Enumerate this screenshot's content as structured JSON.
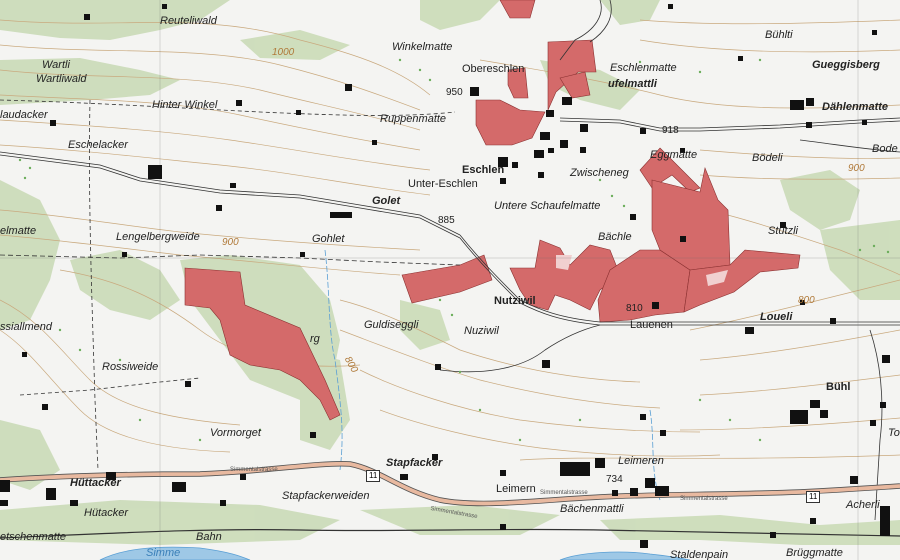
{
  "colors": {
    "background": "#f4f4f2",
    "forest": "#c8d9b4",
    "zone": "#d46a6a",
    "zone_edge": "#8a3030",
    "contour": "#c9a97e",
    "road": "#333333",
    "main_road": "#e8b9a0",
    "water": "#9ec8e6"
  },
  "places": [
    {
      "name": "Reuteliwald",
      "style": "it"
    },
    {
      "name": "Bühlti",
      "style": "it"
    },
    {
      "name": "Wartli",
      "style": "it"
    },
    {
      "name": "Wartliwald",
      "style": "it"
    },
    {
      "name": "Winkelmatte",
      "style": "it"
    },
    {
      "name": "Obereschlen",
      "style": ""
    },
    {
      "name": "Eschlenmatte",
      "style": "it"
    },
    {
      "name": "Gueggisberg",
      "style": "it b"
    },
    {
      "name": "ufelmattli",
      "style": "it b"
    },
    {
      "name": "Hinter Winkel",
      "style": "it"
    },
    {
      "name": "Dählenmatte",
      "style": "it b"
    },
    {
      "name": "laudacker",
      "style": "it"
    },
    {
      "name": "Ruppenmatte",
      "style": "it"
    },
    {
      "name": "Eschelacker",
      "style": "it"
    },
    {
      "name": "Eggmatte",
      "style": "it"
    },
    {
      "name": "Bödeli",
      "style": "it"
    },
    {
      "name": "Bode",
      "style": "it"
    },
    {
      "name": "Eschlen",
      "style": "b"
    },
    {
      "name": "Unter-Eschlen",
      "style": ""
    },
    {
      "name": "Zwischeneg",
      "style": "it"
    },
    {
      "name": "Golet",
      "style": "b it"
    },
    {
      "name": "Untere Schaufelmatte",
      "style": "it"
    },
    {
      "name": "Gohlet",
      "style": "it"
    },
    {
      "name": "Lengelbergweide",
      "style": "it"
    },
    {
      "name": "Bächle",
      "style": "it"
    },
    {
      "name": "Stutzli",
      "style": "it"
    },
    {
      "name": "elmatte",
      "style": "it"
    },
    {
      "name": "Nutziwil",
      "style": "b"
    },
    {
      "name": "Guldiseggli",
      "style": "it"
    },
    {
      "name": "Nuziwil",
      "style": "it"
    },
    {
      "name": "Lauenen",
      "style": ""
    },
    {
      "name": "Loueli",
      "style": "it b"
    },
    {
      "name": "ssiallmend",
      "style": "it"
    },
    {
      "name": "Rossiweide",
      "style": "it"
    },
    {
      "name": "Bühl",
      "style": "b"
    },
    {
      "name": "Vormorget",
      "style": "it"
    },
    {
      "name": "Tor",
      "style": "it"
    },
    {
      "name": "Stapfacker",
      "style": "b it"
    },
    {
      "name": "Leimeren",
      "style": "it"
    },
    {
      "name": "Hüttacker",
      "style": "b it"
    },
    {
      "name": "Leimern",
      "style": ""
    },
    {
      "name": "Hütacker",
      "style": "it"
    },
    {
      "name": "Stapfackerweiden",
      "style": "it"
    },
    {
      "name": "Bächenmattli",
      "style": "it"
    },
    {
      "name": "Acherli",
      "style": "it"
    },
    {
      "name": "etschenmatte",
      "style": "it"
    },
    {
      "name": "Bahn",
      "style": "it"
    },
    {
      "name": "Staldenpain",
      "style": "it"
    },
    {
      "name": "Brüggmatte",
      "style": "it"
    },
    {
      "name": "rg",
      "style": "it"
    },
    {
      "name": "Simme",
      "style": "it"
    }
  ],
  "spot_heights": [
    "950",
    "918",
    "885",
    "810",
    "734"
  ],
  "contour_labels": [
    "1000",
    "900",
    "900",
    "800",
    "800"
  ],
  "route_numbers": [
    "11",
    "11"
  ],
  "road_names": [
    "Simmentalstrasse",
    "Simmentalstrasse",
    "Simmentalstrasse",
    "Simmentalstrasse"
  ]
}
